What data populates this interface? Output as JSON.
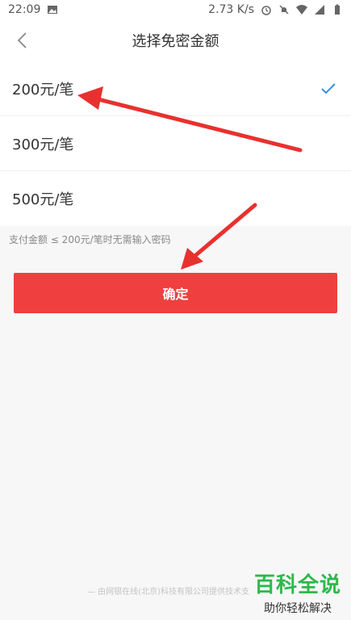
{
  "status": {
    "time": "22:09",
    "speed": "2.73 K/s",
    "icons": [
      "image-icon",
      "alarm-icon",
      "mute-icon",
      "wifi-icon",
      "signal-icon",
      "battery-icon"
    ]
  },
  "header": {
    "title": "选择免密金额",
    "back_icon": "chevron-left-icon"
  },
  "options": [
    {
      "label": "200元/笔",
      "selected": true
    },
    {
      "label": "300元/笔",
      "selected": false
    },
    {
      "label": "500元/笔",
      "selected": false
    }
  ],
  "hint": "支付金额 ≤ 200元/笔时无需输入密码",
  "confirm_label": "确定",
  "footer": "— 由网银在线(北京)科技有限公司提供技术支",
  "watermark": {
    "main": "百科全说",
    "sub": "助你轻松解决"
  },
  "colors": {
    "accent": "#ef3f3f",
    "check": "#3a8ee6",
    "watermark": "#2db84c",
    "arrow": "#e8312f"
  }
}
